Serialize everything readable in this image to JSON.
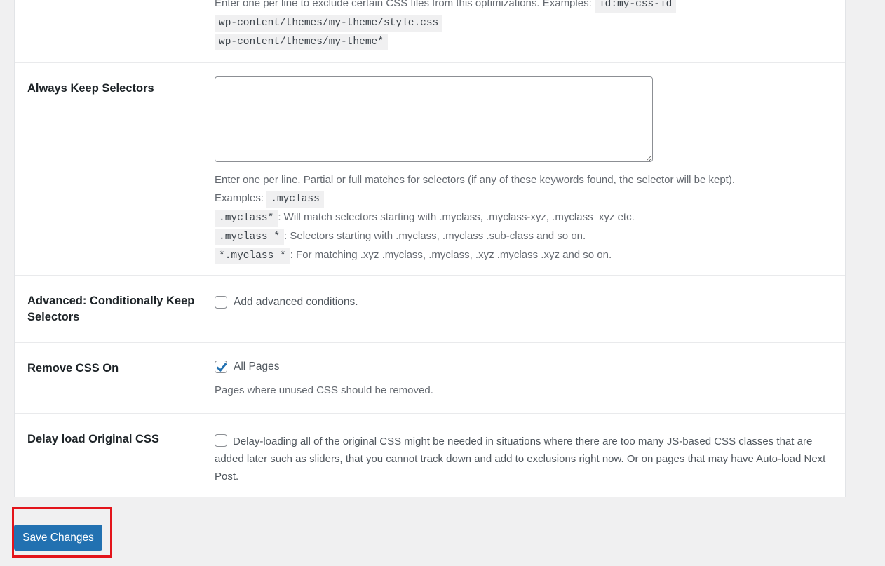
{
  "exclude_files": {
    "description": "Enter one per line to exclude certain CSS files from this optimizations. Examples:",
    "examples": [
      "id:my-css-id",
      "wp-content/themes/my-theme/style.css",
      "wp-content/themes/my-theme*"
    ]
  },
  "always_keep_selectors": {
    "label": "Always Keep Selectors",
    "textarea_value": "",
    "description": "Enter one per line. Partial or full matches for selectors (if any of these keywords found, the selector will be kept).",
    "examples_label": "Examples:",
    "example_code": ".myclass",
    "lines": [
      {
        "code": ".myclass*",
        "text": ": Will match selectors starting with .myclass, .myclass-xyz, .myclass_xyz etc."
      },
      {
        "code": ".myclass *",
        "text": ": Selectors starting with .myclass, .myclass .sub-class and so on."
      },
      {
        "code": "*.myclass *",
        "text": ": For matching .xyz .myclass, .myclass, .xyz .myclass .xyz and so on."
      }
    ]
  },
  "advanced_keep": {
    "label": "Advanced: Conditionally Keep Selectors",
    "checkbox_label": "Add advanced conditions.",
    "checked": false
  },
  "remove_css_on": {
    "label": "Remove CSS On",
    "checkbox_label": "All Pages",
    "checked": true,
    "description": "Pages where unused CSS should be removed."
  },
  "delay_load": {
    "label": "Delay load Original CSS",
    "checked": false,
    "description": "Delay-loading all of the original CSS might be needed in situations where there are too many JS-based CSS classes that are added later such as sliders, that you cannot track down and add to exclusions right now. Or on pages that may have Auto-load Next Post."
  },
  "footer": {
    "save_label": "Save Changes",
    "highlight_color": "#e3141b",
    "button_color": "#2271b1"
  }
}
